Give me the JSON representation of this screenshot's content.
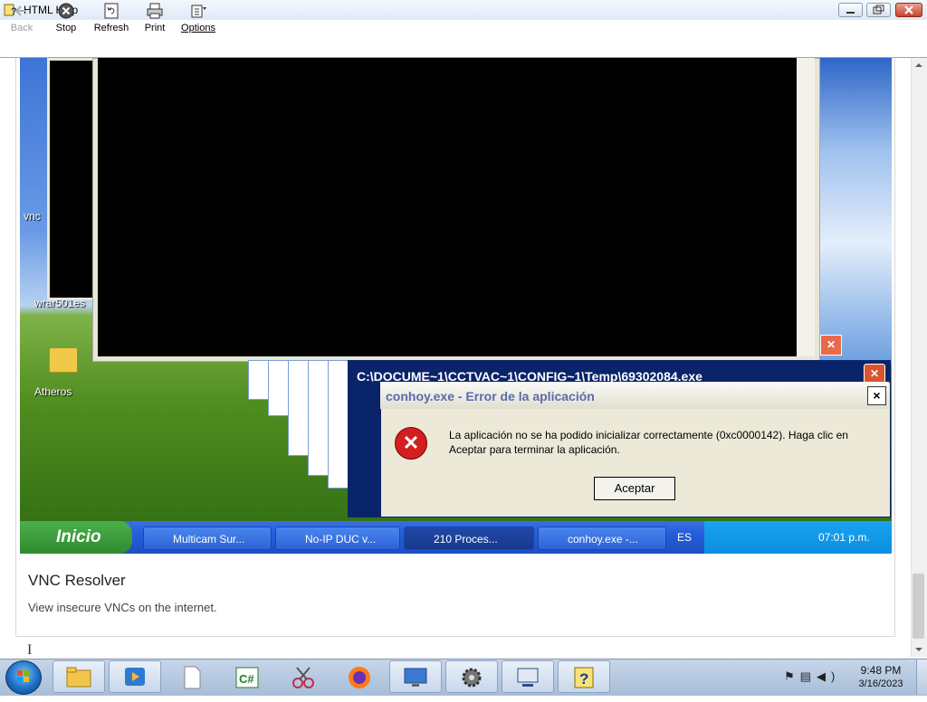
{
  "window": {
    "title": "HTML Help",
    "buttons": {
      "minimize": "minimize",
      "maximize": "maximize",
      "close": "close"
    }
  },
  "toolbar": {
    "back_label": "Back",
    "stop_label": "Stop",
    "refresh_label": "Refresh",
    "print_label": "Print",
    "options_label": "Options"
  },
  "screenshot": {
    "desktop_labels": {
      "vnc": "vnc",
      "wrar": "wrar501es",
      "atheros": "Atheros"
    },
    "cmd_window_title": "C:\\DOCUME~1\\CCTVAC~1\\CONFIG~1\\Temp\\69302084.exe",
    "error_dialog": {
      "title": "conhoy.exe - Error de la aplicación",
      "close_glyph": "×",
      "message": "La aplicación no se ha podido inicializar correctamente (0xc0000142). Haga clic en Aceptar para terminar la aplicación.",
      "ok_label": "Aceptar"
    },
    "xp_taskbar": {
      "start_label": "Inicio",
      "tasks": [
        "Multicam Sur...",
        "No-IP DUC v...",
        "210 Proces...",
        "conhoy.exe -..."
      ],
      "language": "ES",
      "clock": "07:01 p.m."
    }
  },
  "item": {
    "title": "VNC Resolver",
    "description": "View insecure VNCs on the internet."
  },
  "taskbar": {
    "time": "9:48 PM",
    "date": "3/16/2023"
  },
  "icons": {
    "back": "back-arrow-icon",
    "stop": "stop-icon",
    "refresh": "refresh-icon",
    "print": "printer-icon",
    "options": "options-icon"
  }
}
